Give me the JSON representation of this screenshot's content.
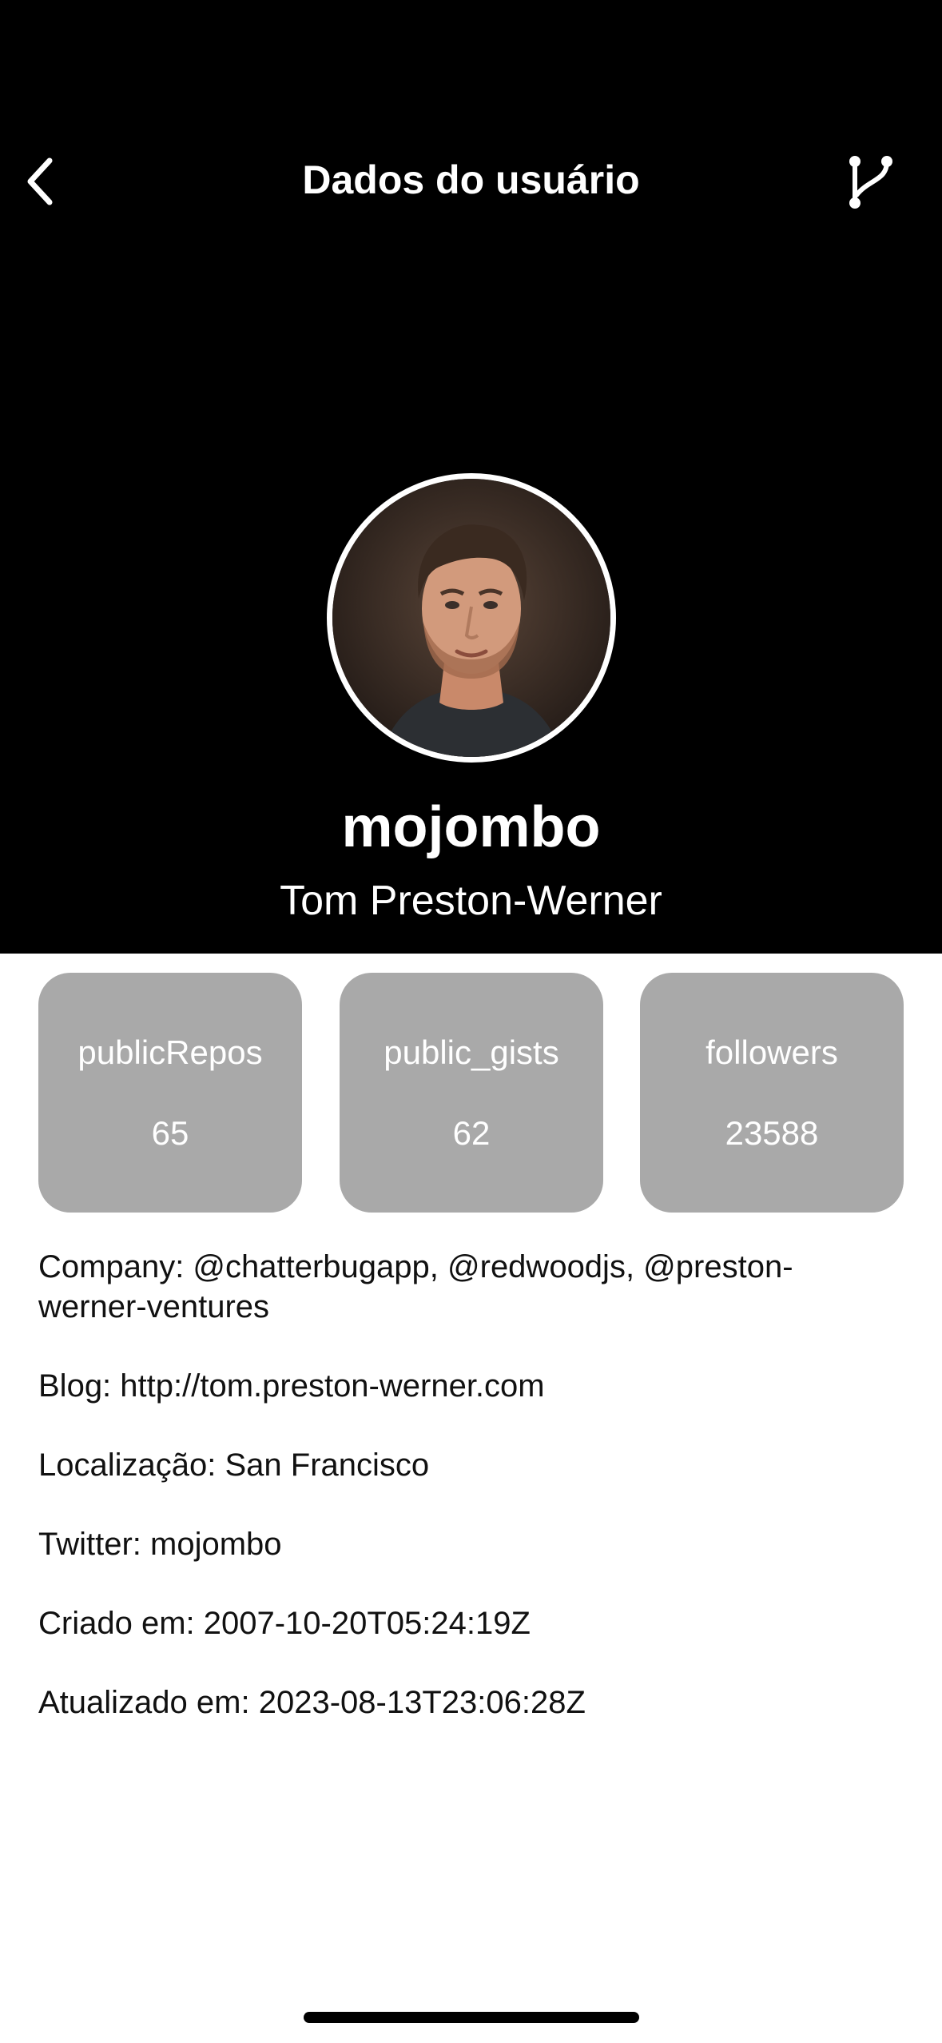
{
  "nav": {
    "title": "Dados do usuário",
    "back_icon": "chevron-left-icon",
    "branch_icon": "git-branch-icon"
  },
  "profile": {
    "username": "mojombo",
    "full_name": "Tom Preston-Werner"
  },
  "stats": [
    {
      "label": "publicRepos",
      "value": "65"
    },
    {
      "label": "public_gists",
      "value": "62"
    },
    {
      "label": "followers",
      "value": "23588"
    }
  ],
  "details": {
    "company": "Company: @chatterbugapp, @redwoodjs, @preston-werner-ventures",
    "blog": "Blog: http://tom.preston-werner.com",
    "location": "Localização: San Francisco",
    "twitter": "Twitter: mojombo",
    "created": "Criado em: 2007-10-20T05:24:19Z",
    "updated": "Atualizado em: 2023-08-13T23:06:28Z"
  },
  "colors": {
    "header_bg": "#000000",
    "card_bg": "#a9a9a9",
    "text_dark": "#111111"
  }
}
